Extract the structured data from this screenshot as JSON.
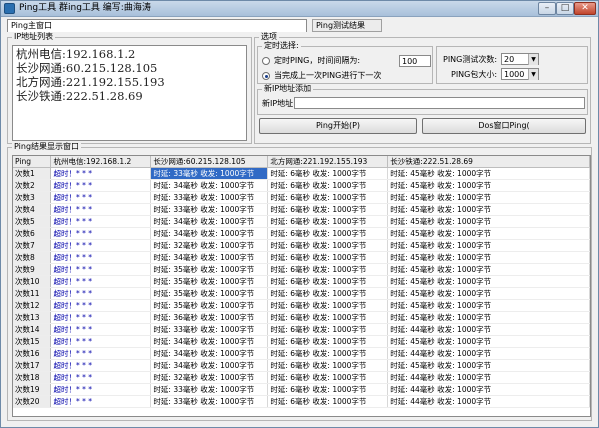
{
  "window": {
    "title": "Ping工具 群ing工具  编写:曲海涛",
    "app_icon": "app-icon",
    "minimize_label": "–",
    "maximize_label": "□",
    "close_label": "✕"
  },
  "tabs": [
    {
      "label": "Ping主窗口",
      "active": true
    },
    {
      "label": "Ping测试结果",
      "active": false
    }
  ],
  "ip_list": {
    "legend": "IP地址列表",
    "lines": [
      "杭州电信:192.168.1.2",
      "长沙网通:60.215.128.105",
      "北方网通:221.192.155.193",
      "长沙铁通:222.51.28.69"
    ]
  },
  "options": {
    "legend": "选项",
    "timer": {
      "legend": "定时选择:",
      "radio_interval_label": "定时PING，时间间隔为:",
      "interval_value": "100",
      "radio_sequential_label": "当完成上一次PING进行下一次",
      "selected": "sequential"
    },
    "ping_count_label": "PING测试次数:",
    "ping_count_value": "20",
    "packet_size_label": "PING包大小:",
    "packet_size_value": "1000",
    "new_ip": {
      "legend": "新IP地址添加",
      "label": "新IP地址",
      "value": ""
    },
    "start_button": "Ping开始(P)",
    "dos_button": "Dos窗口Ping(",
    "accent_color": "#316ac5"
  },
  "results": {
    "legend": "Ping结果显示窗口",
    "columns": [
      "Ping",
      "杭州电信:192.168.1.2",
      "长沙网通:60.215.128.105",
      "北方网通:221.192.155.193",
      "长沙铁通:222.51.28.69"
    ],
    "rows": [
      [
        "次数1",
        "超时！* * *",
        "时延: 33毫秒 收发: 1000字节",
        "时延: 6毫秒 收发: 1000字节",
        "时延: 45毫秒 收发: 1000字节"
      ],
      [
        "次数2",
        "超时！* * *",
        "时延: 34毫秒 收发: 1000字节",
        "时延: 6毫秒 收发: 1000字节",
        "时延: 45毫秒 收发: 1000字节"
      ],
      [
        "次数3",
        "超时！* * *",
        "时延: 33毫秒 收发: 1000字节",
        "时延: 6毫秒 收发: 1000字节",
        "时延: 45毫秒 收发: 1000字节"
      ],
      [
        "次数4",
        "超时！* * *",
        "时延: 33毫秒 收发: 1000字节",
        "时延: 6毫秒 收发: 1000字节",
        "时延: 45毫秒 收发: 1000字节"
      ],
      [
        "次数5",
        "超时！* * *",
        "时延: 34毫秒 收发: 1000字节",
        "时延: 6毫秒 收发: 1000字节",
        "时延: 45毫秒 收发: 1000字节"
      ],
      [
        "次数6",
        "超时！* * *",
        "时延: 34毫秒 收发: 1000字节",
        "时延: 6毫秒 收发: 1000字节",
        "时延: 45毫秒 收发: 1000字节"
      ],
      [
        "次数7",
        "超时！* * *",
        "时延: 32毫秒 收发: 1000字节",
        "时延: 6毫秒 收发: 1000字节",
        "时延: 45毫秒 收发: 1000字节"
      ],
      [
        "次数8",
        "超时！* * *",
        "时延: 34毫秒 收发: 1000字节",
        "时延: 6毫秒 收发: 1000字节",
        "时延: 45毫秒 收发: 1000字节"
      ],
      [
        "次数9",
        "超时！* * *",
        "时延: 35毫秒 收发: 1000字节",
        "时延: 6毫秒 收发: 1000字节",
        "时延: 45毫秒 收发: 1000字节"
      ],
      [
        "次数10",
        "超时！* * *",
        "时延: 35毫秒 收发: 1000字节",
        "时延: 6毫秒 收发: 1000字节",
        "时延: 45毫秒 收发: 1000字节"
      ],
      [
        "次数11",
        "超时！* * *",
        "时延: 35毫秒 收发: 1000字节",
        "时延: 6毫秒 收发: 1000字节",
        "时延: 45毫秒 收发: 1000字节"
      ],
      [
        "次数12",
        "超时！* * *",
        "时延: 35毫秒 收发: 1000字节",
        "时延: 6毫秒 收发: 1000字节",
        "时延: 45毫秒 收发: 1000字节"
      ],
      [
        "次数13",
        "超时！* * *",
        "时延: 36毫秒 收发: 1000字节",
        "时延: 6毫秒 收发: 1000字节",
        "时延: 45毫秒 收发: 1000字节"
      ],
      [
        "次数14",
        "超时！* * *",
        "时延: 33毫秒 收发: 1000字节",
        "时延: 6毫秒 收发: 1000字节",
        "时延: 44毫秒 收发: 1000字节"
      ],
      [
        "次数15",
        "超时！* * *",
        "时延: 34毫秒 收发: 1000字节",
        "时延: 6毫秒 收发: 1000字节",
        "时延: 45毫秒 收发: 1000字节"
      ],
      [
        "次数16",
        "超时！* * *",
        "时延: 34毫秒 收发: 1000字节",
        "时延: 6毫秒 收发: 1000字节",
        "时延: 44毫秒 收发: 1000字节"
      ],
      [
        "次数17",
        "超时！* * *",
        "时延: 34毫秒 收发: 1000字节",
        "时延: 6毫秒 收发: 1000字节",
        "时延: 45毫秒 收发: 1000字节"
      ],
      [
        "次数18",
        "超时！* * *",
        "时延: 32毫秒 收发: 1000字节",
        "时延: 6毫秒 收发: 1000字节",
        "时延: 44毫秒 收发: 1000字节"
      ],
      [
        "次数19",
        "超时！* * *",
        "时延: 33毫秒 收发: 1000字节",
        "时延: 6毫秒 收发: 1000字节",
        "时延: 44毫秒 收发: 1000字节"
      ],
      [
        "次数20",
        "超时！* * *",
        "时延: 33毫秒 收发: 1000字节",
        "时延: 6毫秒 收发: 1000字节",
        "时延: 44毫秒 收发: 1000字节"
      ]
    ]
  }
}
